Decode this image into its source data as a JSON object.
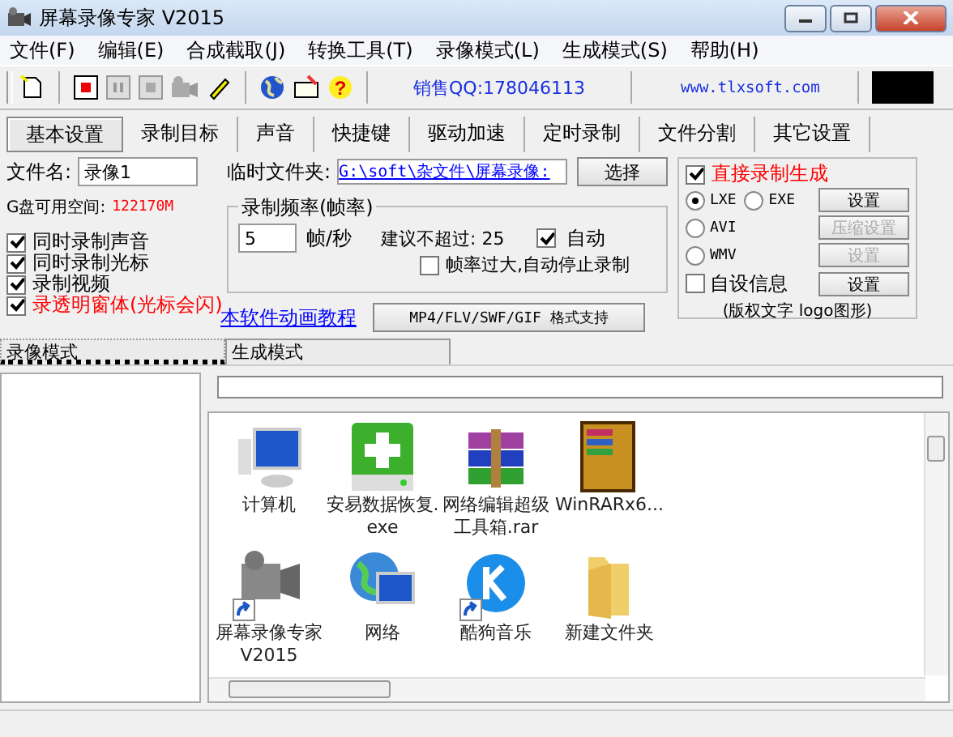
{
  "window": {
    "title": "屏幕录像专家 V2015"
  },
  "menu": [
    "文件(F)",
    "编辑(E)",
    "合成截取(J)",
    "转换工具(T)",
    "录像模式(L)",
    "生成模式(S)",
    "帮助(H)"
  ],
  "toolbar": {
    "help_icon": "?",
    "sales_qq": "销售QQ:178046113",
    "website": "www.tlxsoft.com"
  },
  "tabs": [
    {
      "label": "基本设置",
      "selected": true
    },
    {
      "label": "录制目标",
      "selected": false
    },
    {
      "label": "声音",
      "selected": false
    },
    {
      "label": "快捷键",
      "selected": false
    },
    {
      "label": "驱动加速",
      "selected": false
    },
    {
      "label": "定时录制",
      "selected": false
    },
    {
      "label": "文件分割",
      "selected": false
    },
    {
      "label": "其它设置",
      "selected": false
    }
  ],
  "basic": {
    "filename_label": "文件名:",
    "filename_value": "录像1",
    "temp_folder_label": "临时文件夹:",
    "temp_folder_value": "G:\\soft\\杂文件\\屏幕录像:",
    "choose_button": "选择",
    "disk_space_label": "G盘可用空间:",
    "disk_space_value": "122170M",
    "options": [
      {
        "label": "同时录制声音",
        "checked": true,
        "warning": false
      },
      {
        "label": "同时录制光标",
        "checked": true,
        "warning": false
      },
      {
        "label": "录制视频",
        "checked": true,
        "warning": false
      },
      {
        "label": "录透明窗体(光标会闪)",
        "checked": true,
        "warning": true
      }
    ],
    "tutorial_link": "本软件动画教程",
    "frame_rate": {
      "title": "录制频率(帧率)",
      "value": "5",
      "unit": "帧/秒",
      "suggestion": "建议不超过: 25",
      "auto": {
        "label": "自动",
        "checked": true
      },
      "auto_stop": {
        "label": "帧率过大,自动停止录制",
        "checked": false
      }
    },
    "format_button": "MP4/FLV/SWF/GIF  格式支持"
  },
  "output": {
    "direct": {
      "label": "直接录制生成",
      "checked": true
    },
    "rows": [
      {
        "radios": [
          {
            "label": "LXE",
            "selected": true
          },
          {
            "label": "EXE",
            "selected": false
          }
        ],
        "button": {
          "label": "设置",
          "disabled": false
        }
      },
      {
        "radios": [
          {
            "label": "AVI",
            "selected": false
          }
        ],
        "button": {
          "label": "压缩设置",
          "disabled": true
        }
      },
      {
        "radios": [
          {
            "label": "WMV",
            "selected": false
          }
        ],
        "button": {
          "label": "设置",
          "disabled": true
        }
      }
    ],
    "custom_info": {
      "label": "自设信息",
      "checked": false,
      "button": "设置"
    },
    "note": "(版权文字 logo图形)"
  },
  "mode_tabs": [
    {
      "label": "录像模式",
      "selected": true
    },
    {
      "label": "生成模式",
      "selected": false
    }
  ],
  "files": [
    {
      "name": "计算机",
      "kind": "computer",
      "shortcut": false
    },
    {
      "name": "安易数据恢复.exe",
      "kind": "drive",
      "shortcut": false
    },
    {
      "name": "网络编辑超级工具箱.rar",
      "kind": "archive",
      "shortcut": false
    },
    {
      "name": "WinRARx6...",
      "kind": "book",
      "shortcut": false
    },
    {
      "name": "屏幕录像专家V2015",
      "kind": "camera",
      "shortcut": true
    },
    {
      "name": "网络",
      "kind": "network",
      "shortcut": false
    },
    {
      "name": "酷狗音乐",
      "kind": "music",
      "shortcut": true
    },
    {
      "name": "新建文件夹",
      "kind": "folder",
      "shortcut": false
    }
  ]
}
